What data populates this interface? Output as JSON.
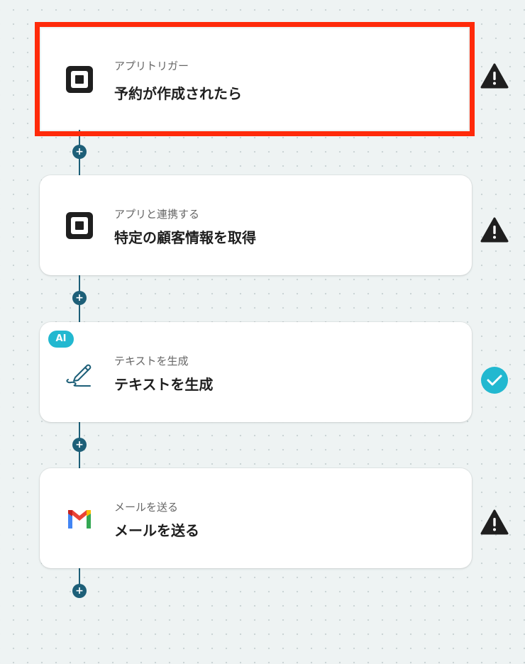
{
  "steps": [
    {
      "subtitle": "アプリトリガー",
      "title": "予約が作成されたら",
      "icon": "square-app-icon",
      "status": "warning",
      "selected": true,
      "badge": ""
    },
    {
      "subtitle": "アプリと連携する",
      "title": "特定の顧客情報を取得",
      "icon": "square-app-icon",
      "status": "warning",
      "selected": false,
      "badge": ""
    },
    {
      "subtitle": "テキストを生成",
      "title": "テキストを生成",
      "icon": "pen-icon",
      "status": "ok",
      "selected": false,
      "badge": "AI"
    },
    {
      "subtitle": "メールを送る",
      "title": "メールを送る",
      "icon": "gmail-icon",
      "status": "warning",
      "selected": false,
      "badge": ""
    }
  ],
  "add_step_symbol": "+",
  "colors": {
    "accent": "#1d5f78",
    "selection": "#ff2a0a",
    "success": "#22b8d0",
    "warning": "#1f1f1f"
  }
}
